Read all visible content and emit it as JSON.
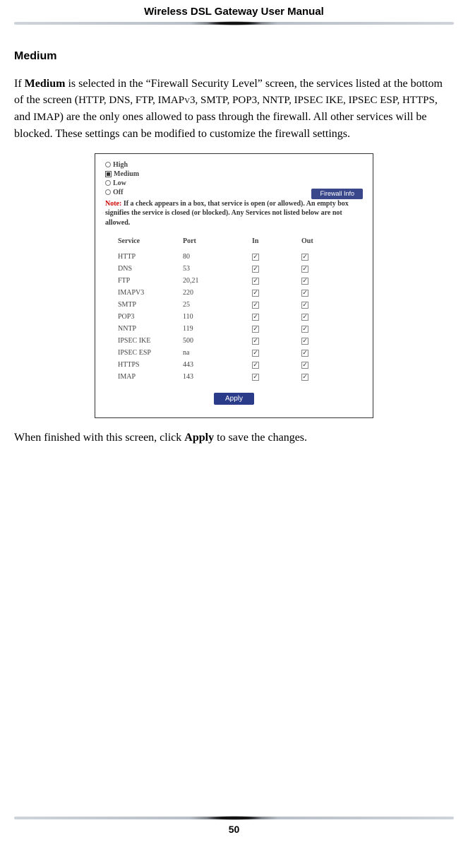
{
  "header": {
    "title": "Wireless DSL Gateway User Manual"
  },
  "section": {
    "heading": "Medium"
  },
  "para1": {
    "t1": "If ",
    "bold1": "Medium",
    "t2": " is selected in the “Firewall Security Level” screen, the services listed at the bottom of the screen (",
    "sc1": "HTTP, DNS, FTP, IMAPv3, SMTP, POP3, NNTP, IPSEC IKE, IPSEC ESP, HTTPS",
    "t3": ", and ",
    "sc2": "IMAP",
    "t4": ") are the only ones allowed to pass through the firewall. All other services will be blocked. These settings can be modified to customize the firewall settings."
  },
  "screenshot": {
    "levels": [
      "High",
      "Medium",
      "Low",
      "Off"
    ],
    "selected_level": "Medium",
    "info_button": "Firewall Info",
    "note_label": "Note:",
    "note_text": " If a check appears in a box, that service is open (or allowed). An empty box signifies the service is closed (or blocked). Any Services not listed below are not allowed.",
    "columns": [
      "Service",
      "Port",
      "In",
      "Out"
    ],
    "rows": [
      {
        "service": "HTTP",
        "port": "80",
        "in": true,
        "out": true
      },
      {
        "service": "DNS",
        "port": "53",
        "in": true,
        "out": true
      },
      {
        "service": "FTP",
        "port": "20,21",
        "in": true,
        "out": true
      },
      {
        "service": "IMAPV3",
        "port": "220",
        "in": true,
        "out": true
      },
      {
        "service": "SMTP",
        "port": "25",
        "in": true,
        "out": true
      },
      {
        "service": "POP3",
        "port": "110",
        "in": true,
        "out": true
      },
      {
        "service": "NNTP",
        "port": "119",
        "in": true,
        "out": true
      },
      {
        "service": "IPSEC IKE",
        "port": "500",
        "in": true,
        "out": true
      },
      {
        "service": "IPSEC ESP",
        "port": "na",
        "in": true,
        "out": true
      },
      {
        "service": "HTTPS",
        "port": "443",
        "in": true,
        "out": true
      },
      {
        "service": "IMAP",
        "port": "143",
        "in": true,
        "out": true
      }
    ],
    "apply": "Apply"
  },
  "para2": {
    "t1": "When finished with this screen, click ",
    "bold1": "Apply",
    "t2": " to save the changes."
  },
  "footer": {
    "page_number": "50"
  }
}
